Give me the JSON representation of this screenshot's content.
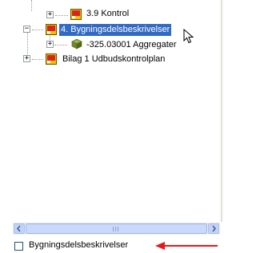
{
  "tree": {
    "items": [
      {
        "label": "3.9 Kontrol",
        "expander": "+",
        "icon": "layer-icon-red-yellow"
      },
      {
        "label": "4. Bygningsdelsbeskrivelser",
        "expander": "−",
        "icon": "layer-icon-red-yellow",
        "selected": true
      },
      {
        "label": "-325.03001 Aggregater",
        "expander": "+",
        "icon": "object-box-icon"
      },
      {
        "label": "Bilag 1 Udbudskontrolplan",
        "expander": "+",
        "icon": "layer-icon-red-yellow"
      }
    ]
  },
  "status": {
    "checkbox_checked": false,
    "label": "Bygningsdelsbeskrivelser"
  },
  "colors": {
    "selection": "#316ac5",
    "annotation_arrow": "#e8171d"
  }
}
